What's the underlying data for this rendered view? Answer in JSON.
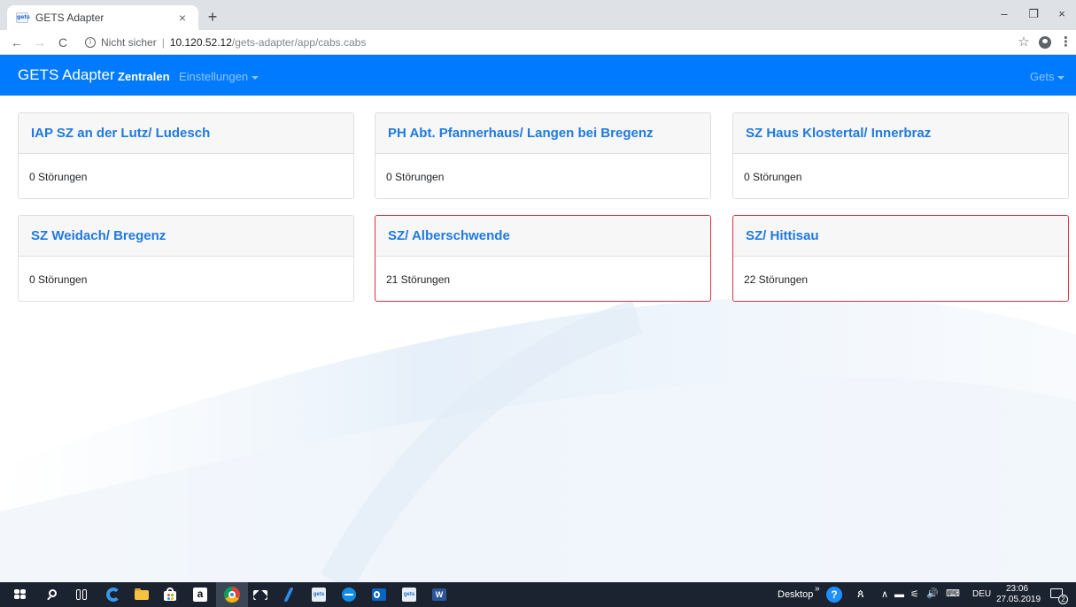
{
  "browser": {
    "tab_title": "GETS Adapter",
    "tab_favicon_text": "gets",
    "tab_close": "×",
    "new_tab": "+",
    "window_controls": {
      "minimize": "–",
      "maximize": "❐",
      "close": "×"
    },
    "nav": {
      "back": "←",
      "forward": "→",
      "reload": "C"
    },
    "security_icon": "i",
    "security_text": "Nicht sicher",
    "separator": "|",
    "url_host": "10.120.52.12",
    "url_path": "/gets-adapter/app/cabs.cabs",
    "bookmark_star": "☆",
    "menu": "⋮"
  },
  "navbar": {
    "brand": "GETS Adapter",
    "links": [
      {
        "label": "Zentralen",
        "active": true
      },
      {
        "label": "Einstellungen",
        "dropdown": true
      }
    ],
    "user_menu": "Gets",
    "color": "#007bff"
  },
  "cards": [
    {
      "title": "IAP SZ an der Lutz/ Ludesch",
      "count": 0,
      "body": "0 Störungen",
      "alert": false
    },
    {
      "title": "PH Abt. Pfannerhaus/ Langen bei Bregenz",
      "count": 0,
      "body": "0 Störungen",
      "alert": false
    },
    {
      "title": "SZ Haus Klostertal/ Innerbraz",
      "count": 0,
      "body": "0 Störungen",
      "alert": false
    },
    {
      "title": "SZ Weidach/ Bregenz",
      "count": 0,
      "body": "0 Störungen",
      "alert": false
    },
    {
      "title": "SZ/ Alberschwende",
      "count": 21,
      "body": "21 Störungen",
      "alert": true
    },
    {
      "title": "SZ/ Hittisau",
      "count": 22,
      "body": "22 Störungen",
      "alert": true
    }
  ],
  "taskbar": {
    "apps": [
      "start-button",
      "search-icon",
      "task-view-icon",
      "edge-icon",
      "file-explorer-icon",
      "store-icon",
      "amazon-icon",
      "chrome-icon",
      "mail-icon",
      "app-icon",
      "gets-icon",
      "teamviewer-icon",
      "outlook-icon",
      "gets-icon",
      "word-icon"
    ],
    "app_badges": {
      "gets": "gets",
      "amazon": "a",
      "word": "W"
    },
    "desktop_label": "Desktop",
    "overflow": "»",
    "help": "?",
    "people": "ጰ",
    "tray_up": "∧",
    "tray_icons": [
      "▬",
      "⚟",
      "🔊",
      "⌨"
    ],
    "language": "DEU",
    "time": "23:06",
    "date": "27.05.2019",
    "notification_count": "2"
  },
  "colors": {
    "accent": "#007bff",
    "card_title": "#1f7ae0",
    "alert_border": "#dc3545",
    "taskbar": "#1c2330"
  }
}
